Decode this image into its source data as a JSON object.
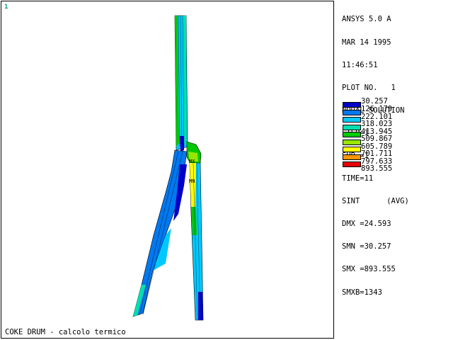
{
  "window_number": "1",
  "caption": "COKE DRUM - calcolo termico",
  "info": {
    "lines": [
      "ANSYS 5.0 A",
      "MAR 14 1995",
      "11:46:51",
      "PLOT NO.   1",
      "NODAL SOLUTION",
      "STEP=1",
      "SUB =1",
      "TIME=11",
      "SINT      (AVG)",
      "DMX =24.593",
      "SMN =30.257",
      "SMX =893.555",
      "SMXB=1343"
    ]
  },
  "legend": {
    "first_value": "30.257",
    "items": [
      {
        "value": "126.179",
        "color": "#0000c8"
      },
      {
        "value": "222.101",
        "color": "#0078f0"
      },
      {
        "value": "318.023",
        "color": "#00c8ff"
      },
      {
        "value": "413.945",
        "color": "#00e0b0"
      },
      {
        "value": "509.867",
        "color": "#00c800"
      },
      {
        "value": "605.789",
        "color": "#96e600"
      },
      {
        "value": "701.711",
        "color": "#ffff00"
      },
      {
        "value": "797.633",
        "color": "#ff9600"
      },
      {
        "value": "893.555",
        "color": "#e60000"
      }
    ]
  },
  "model_labels": {
    "max": "MX",
    "min": "MN"
  }
}
